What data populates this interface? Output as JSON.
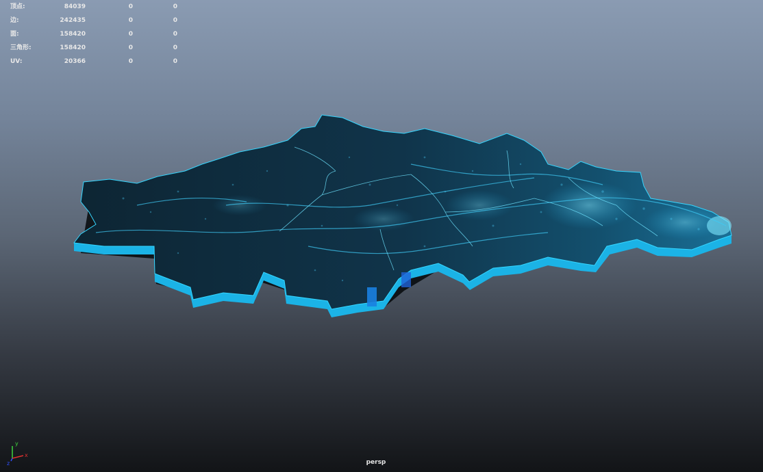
{
  "hud": {
    "rows": [
      {
        "label": "顶点:",
        "total": "84039",
        "selected": "0",
        "uv": "0"
      },
      {
        "label": "边:",
        "total": "242435",
        "selected": "0",
        "uv": "0"
      },
      {
        "label": "面:",
        "total": "158420",
        "selected": "0",
        "uv": "0"
      },
      {
        "label": "三角形:",
        "total": "158420",
        "selected": "0",
        "uv": "0"
      },
      {
        "label": "UV:",
        "total": "20366",
        "selected": "0",
        "uv": "0"
      }
    ]
  },
  "viewport": {
    "camera": "persp",
    "axis": {
      "x": "x",
      "y": "y",
      "z": "z"
    }
  },
  "colors": {
    "accent": "#29c8f0",
    "map_top": "#0e2a3a",
    "map_side": "#1bb3e6",
    "shadow": "#05080a"
  },
  "icons": {
    "axis_gizmo": "axis-gizmo-icon"
  }
}
